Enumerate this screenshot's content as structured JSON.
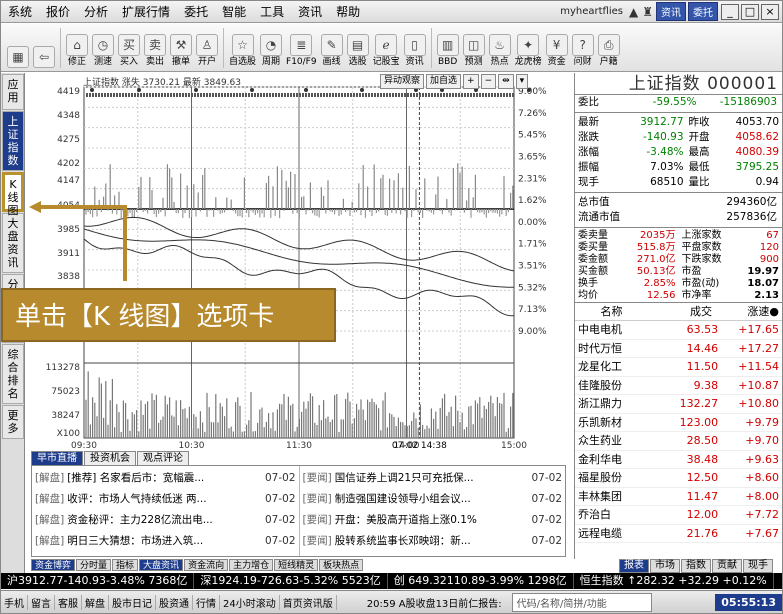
{
  "menubar": {
    "items": [
      "系统",
      "报价",
      "分析",
      "扩展行情",
      "委托",
      "智能",
      "工具",
      "资讯",
      "帮助"
    ],
    "account": "myheartflies",
    "btn_news": "资讯",
    "btn_trade": "委托",
    "win_min": "_",
    "win_max": "□",
    "win_close": "×"
  },
  "toolbar": {
    "items": [
      {
        "label": "",
        "icon": "grid-icon"
      },
      {
        "label": "",
        "icon": "back-icon"
      },
      {
        "label": "修正",
        "icon": "house-icon"
      },
      {
        "label": "测速",
        "icon": "timer-icon"
      },
      {
        "label": "买入",
        "icon": "buy-icon"
      },
      {
        "label": "卖出",
        "icon": "sell-icon"
      },
      {
        "label": "撤单",
        "icon": "hammer-icon"
      },
      {
        "label": "开户",
        "icon": "person-icon"
      },
      {
        "label": "自选股",
        "icon": "star-icon"
      },
      {
        "label": "周期",
        "icon": "clock-icon"
      },
      {
        "label": "F10/F9",
        "icon": "f10-icon"
      },
      {
        "label": "画线",
        "icon": "pen-icon"
      },
      {
        "label": "选股",
        "icon": "filter-icon"
      },
      {
        "label": "记股宝",
        "icon": "ie-icon"
      },
      {
        "label": "资讯",
        "icon": "book-icon"
      },
      {
        "label": "BBD",
        "icon": "bbd-icon"
      },
      {
        "label": "预测",
        "icon": "forecast-icon"
      },
      {
        "label": "热点",
        "icon": "fire-icon"
      },
      {
        "label": "龙虎榜",
        "icon": "dragon-icon"
      },
      {
        "label": "资金",
        "icon": "money-icon"
      },
      {
        "label": "问财",
        "icon": "ask-icon"
      },
      {
        "label": "户籍",
        "icon": "printer-icon"
      }
    ]
  },
  "sidebar": {
    "tabs": [
      "应用",
      "上证指数",
      "K线图",
      "大盘资讯",
      "分时",
      "自选",
      "综合排名",
      "更多"
    ]
  },
  "chart": {
    "info_name": "上证指数",
    "info_change_label": "涨失",
    "info_change": "3730.21",
    "info_latest_label": "最新",
    "info_latest": "3849.63",
    "btn_abnormal": "异动观察",
    "btn_add": "加自选",
    "left_ticks": [
      "4419",
      "4348",
      "4275",
      "4202",
      "4147",
      "4054",
      "3985",
      "3911",
      "3838",
      "3766",
      "",
      "113278",
      "75023",
      "38247"
    ],
    "right_ticks": [
      "9.00%",
      "7.26%",
      "5.45%",
      "3.65%",
      "2.31%",
      "1.62%",
      "0.00%",
      "1.71%",
      "3.51%",
      "5.32%",
      "7.13%",
      "9.00%"
    ],
    "x_ticks": [
      "09:30",
      "10:30",
      "11:30",
      "14:00",
      "15:00"
    ],
    "cursor_time": "07-02 14:38",
    "volume_unit": "X100"
  },
  "tooltip": {
    "text": "单击【K 线图】选项卡"
  },
  "news": {
    "tabs": [
      "早市直播",
      "投资机会",
      "观点评论"
    ],
    "left": [
      {
        "tag": "[解盘]",
        "title": "[推荐] 名家看后市：宽幅震...",
        "date": "07-02"
      },
      {
        "tag": "[解盘]",
        "title": "收评：市场人气持续低迷 两...",
        "date": "07-02"
      },
      {
        "tag": "[解盘]",
        "title": "资金秘评：主力228亿流出电...",
        "date": "07-02"
      },
      {
        "tag": "[解盘]",
        "title": "明日三大猜想：市场进入筑...",
        "date": "07-02"
      }
    ],
    "right": [
      {
        "tag": "[要闻]",
        "title": "国信证券上调21只可充抵保...",
        "date": "07-02"
      },
      {
        "tag": "[要闻]",
        "title": "制造强国建设领导小组会议...",
        "date": "07-02"
      },
      {
        "tag": "[要闻]",
        "title": "开盘：美股高开道指上涨0.1%",
        "date": "07-02"
      },
      {
        "tag": "[要闻]",
        "title": "股转系统监事长邓映翊：新...",
        "date": "07-02"
      }
    ]
  },
  "quote": {
    "title": "上证指数 000001",
    "weibi_label": "委比",
    "weibi_pct": "-59.55%",
    "weibi_val": "-15186903",
    "rows": [
      {
        "k": "最新",
        "v": "3912.77",
        "k2": "昨收",
        "v2": "4053.70",
        "c": "grn",
        "c2": "blk"
      },
      {
        "k": "涨跌",
        "v": "-140.93",
        "k2": "开盘",
        "v2": "4058.62",
        "c": "grn",
        "c2": "red"
      },
      {
        "k": "涨幅",
        "v": "-3.48%",
        "k2": "最高",
        "v2": "4080.39",
        "c": "grn",
        "c2": "red"
      },
      {
        "k": "振幅",
        "v": "7.03%",
        "k2": "最低",
        "v2": "3795.25",
        "c": "blk",
        "c2": "grn"
      },
      {
        "k": "现手",
        "v": "68510",
        "k2": "量比",
        "v2": "0.94",
        "c": "blk",
        "c2": "blk"
      }
    ],
    "mktcap_label": "总市值",
    "mktcap": "294360亿",
    "float_label": "流通市值",
    "float": "257836亿",
    "mid": [
      {
        "a": "委卖量",
        "b": "2035万",
        "c": "上涨家数",
        "d": "67"
      },
      {
        "a": "委买量",
        "b": "515.8万",
        "c": "平盘家数",
        "d": "120"
      },
      {
        "a": "委金额",
        "b": "271.0亿",
        "c": "下跌家数",
        "d": "900"
      },
      {
        "a": "买金额",
        "b": "50.13亿",
        "c": "市盈",
        "d": "19.97"
      },
      {
        "a": "换手",
        "b": "2.85%",
        "c": "市盈(动)",
        "d": "18.07"
      },
      {
        "a": "均价",
        "b": "12.56",
        "c": "市净率",
        "d": "2.13"
      }
    ],
    "list_head": [
      "名称",
      "成交",
      "涨速●"
    ],
    "list": [
      {
        "name": "中电电机",
        "price": "63.53",
        "chg": "+17.65"
      },
      {
        "name": "时代万恒",
        "price": "14.46",
        "chg": "+17.27"
      },
      {
        "name": "龙星化工",
        "price": "11.50",
        "chg": "+11.54"
      },
      {
        "name": "佳隆股份",
        "price": "9.38",
        "chg": "+10.87"
      },
      {
        "name": "浙江鼎力",
        "price": "132.27",
        "chg": "+10.80"
      },
      {
        "name": "乐凯新材",
        "price": "123.00",
        "chg": "+9.79"
      },
      {
        "name": "众生药业",
        "price": "28.50",
        "chg": "+9.70"
      },
      {
        "name": "金利华电",
        "price": "38.48",
        "chg": "+9.63"
      },
      {
        "name": "福星股份",
        "price": "12.50",
        "chg": "+8.60"
      },
      {
        "name": "丰林集团",
        "price": "11.47",
        "chg": "+8.00"
      },
      {
        "name": "乔治白",
        "price": "12.00",
        "chg": "+7.72"
      },
      {
        "name": "远程电缆",
        "price": "21.76",
        "chg": "+7.67"
      }
    ]
  },
  "bottom_tabs": [
    "资金博弈",
    "分时量",
    "指标",
    "大盘资讯",
    "资金流向",
    "主力增仓",
    "短线精灵",
    "板块热点"
  ],
  "quote_tabs": [
    "报表",
    "市场",
    "指数",
    "贡献",
    "现手"
  ],
  "ticker": [
    "沪3912.77-140.93-3.48% 7368亿",
    "深1924.19-726.63-5.32% 5523亿",
    "创 649.32110.89-3.99% 1298亿",
    "恒生指数 ↑282.32 +32.29 +0.12%"
  ],
  "statusbar": {
    "items": [
      "手机",
      "留言",
      "客服",
      "解盘",
      "股市日记",
      "股资通",
      "行情",
      "24小时滚动",
      "首页资讯版"
    ],
    "message": "20:59 A股收盘13日前仁报告:",
    "search_placeholder": "代码/名称/简拼/功能",
    "clock": "05:55:13"
  }
}
